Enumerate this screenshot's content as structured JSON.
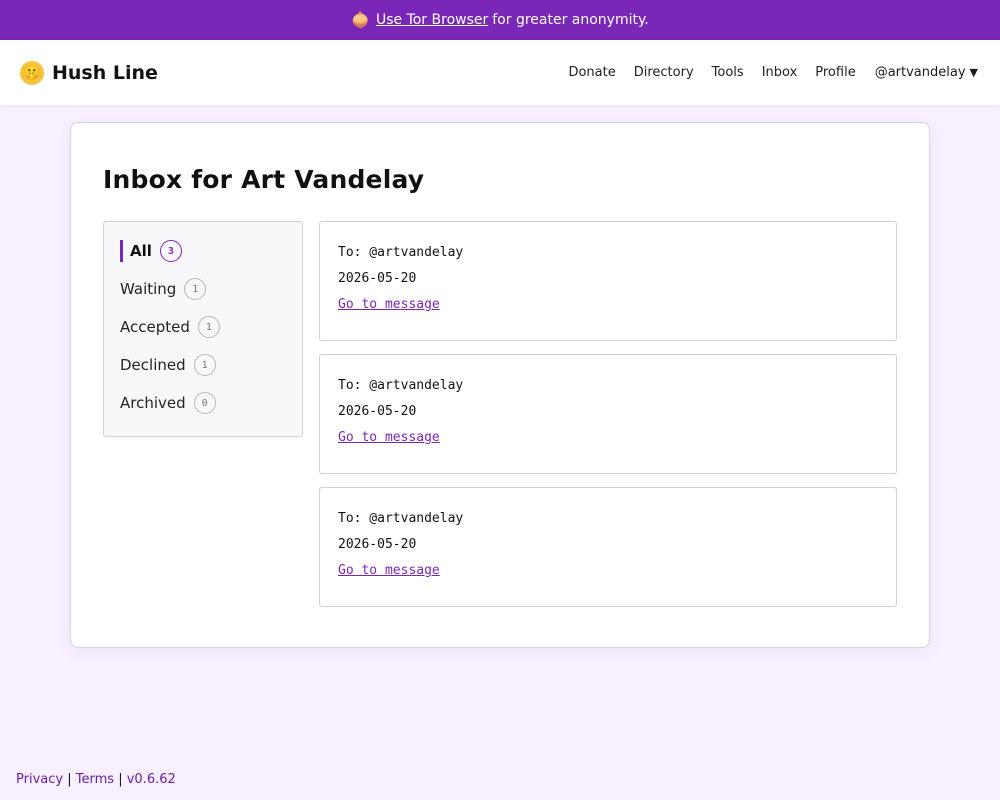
{
  "banner": {
    "link_label": "Use Tor Browser",
    "text": "for greater anonymity.",
    "icon": "onion-icon"
  },
  "header": {
    "brand": "Hush Line",
    "logo_icon": "shushing-face-icon",
    "nav": [
      {
        "label": "Donate"
      },
      {
        "label": "Directory"
      },
      {
        "label": "Tools"
      },
      {
        "label": "Inbox"
      },
      {
        "label": "Profile"
      }
    ],
    "user": "@artvandelay"
  },
  "main": {
    "title": "Inbox for Art Vandelay",
    "filters": [
      {
        "label": "All",
        "count": "3",
        "active": true
      },
      {
        "label": "Waiting",
        "count": "1"
      },
      {
        "label": "Accepted",
        "count": "1"
      },
      {
        "label": "Declined",
        "count": "1"
      },
      {
        "label": "Archived",
        "count": "0"
      }
    ],
    "messages": [
      {
        "to": "To: @artvandelay",
        "date": "2026-05-20",
        "link": "Go to message"
      },
      {
        "to": "To: @artvandelay",
        "date": "2026-05-20",
        "link": "Go to message"
      },
      {
        "to": "To: @artvandelay",
        "date": "2026-05-20",
        "link": "Go to message"
      }
    ]
  },
  "footer": {
    "privacy": "Privacy",
    "sep1": "|",
    "terms": "Terms",
    "sep2": "|",
    "version": "v0.6.62"
  },
  "colors": {
    "accent": "#7a27b8",
    "background": "#f8f0fe"
  }
}
